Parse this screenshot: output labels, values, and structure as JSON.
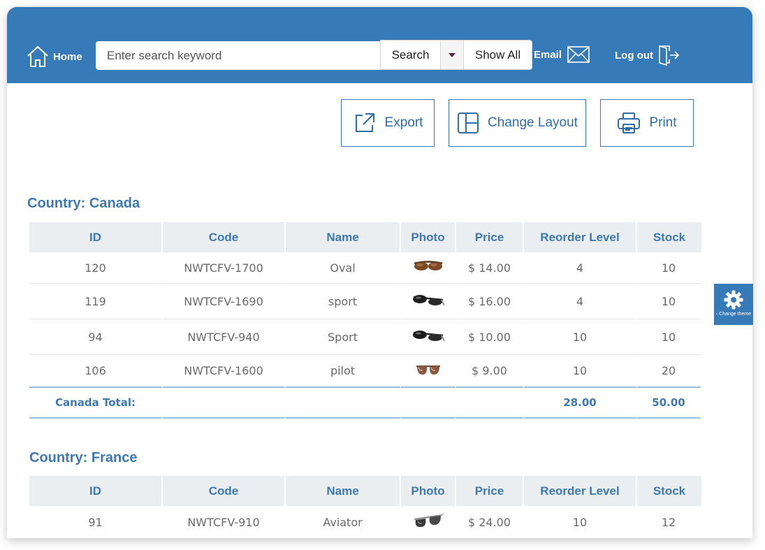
{
  "header": {
    "home_label": "Home",
    "search_placeholder": "Enter search keyword",
    "search_label": "Search",
    "show_all_label": "Show All",
    "email_label": "Email",
    "logout_label": "Log out"
  },
  "toolbar": {
    "export_label": "Export",
    "change_layout_label": "Change Layout",
    "print_label": "Print"
  },
  "columns": [
    "ID",
    "Code",
    "Name",
    "Photo",
    "Price",
    "Reorder Level",
    "Stock"
  ],
  "groups": [
    {
      "title": "Country: Canada",
      "rows": [
        {
          "id": "120",
          "code": "NWTCFV-1700",
          "name": "Oval",
          "photo": "sunglasses-brown-oval-icon",
          "price": "$ 14.00",
          "reorder": "4",
          "stock": "10"
        },
        {
          "id": "119",
          "code": "NWTCFV-1690",
          "name": "sport",
          "photo": "sunglasses-black-sport-icon",
          "price": "$ 16.00",
          "reorder": "4",
          "stock": "10"
        },
        {
          "id": "94",
          "code": "NWTCFV-940",
          "name": "Sport",
          "photo": "sunglasses-black-sport-icon",
          "price": "$ 10.00",
          "reorder": "10",
          "stock": "10"
        },
        {
          "id": "106",
          "code": "NWTCFV-1600",
          "name": "pilot",
          "photo": "sunglasses-brown-pilot-icon",
          "price": "$ 9.00",
          "reorder": "10",
          "stock": "20"
        }
      ],
      "total_label": "Canada Total:",
      "total_reorder": "28.00",
      "total_stock": "50.00"
    },
    {
      "title": "Country: France",
      "rows": [
        {
          "id": "91",
          "code": "NWTCFV-910",
          "name": "Aviator",
          "photo": "sunglasses-aviator-icon",
          "price": "$ 24.00",
          "reorder": "10",
          "stock": "12"
        }
      ]
    }
  ],
  "theme_tab": {
    "label": "Change theme",
    "icon": "gear-icon"
  },
  "colors": {
    "header_bg": "#367ab8",
    "accent": "#3d79b3",
    "table_header_bg": "#eaeef1",
    "cell_text": "#6a6a6a"
  }
}
